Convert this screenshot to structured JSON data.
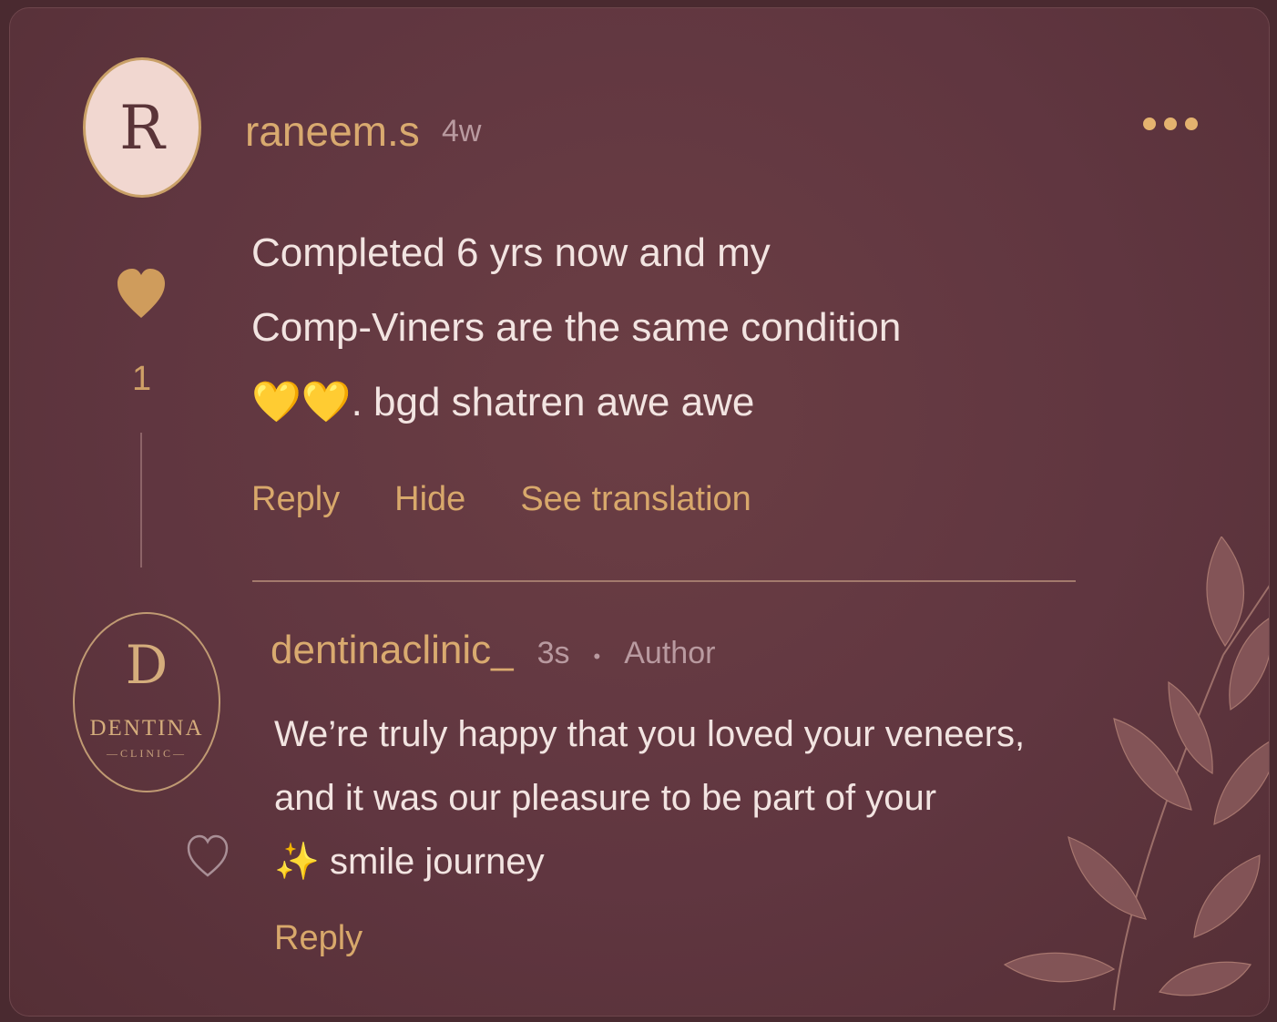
{
  "comment": {
    "avatar_letter": "R",
    "username": "raneem.s",
    "time": "4w",
    "likes": "1",
    "lines": [
      "Completed 6 yrs now and my",
      "Comp-Viners are the same condition",
      ". bgd shatren awe awe"
    ],
    "emoji": "💛💛",
    "actions": {
      "reply": "Reply",
      "hide": "Hide",
      "translate": "See translation"
    }
  },
  "reply": {
    "logo": {
      "letter": "D",
      "name": "DENTINA",
      "sub": "—CLINIC—"
    },
    "username": "dentinaclinic_",
    "time": "3s",
    "separator": "•",
    "badge": "Author",
    "lines": [
      "We’re truly happy that you loved your veneers,",
      "and it was our pleasure to be part of your",
      "smile journey"
    ],
    "sparkle": "✨",
    "action_reply": "Reply"
  },
  "colors": {
    "accent": "#d9aa6f",
    "background": "#603640",
    "text": "#f2e4e1"
  },
  "icons": [
    "more-options-icon",
    "heart-filled-icon",
    "heart-outline-icon",
    "sparkles-icon",
    "leaf-decoration"
  ]
}
